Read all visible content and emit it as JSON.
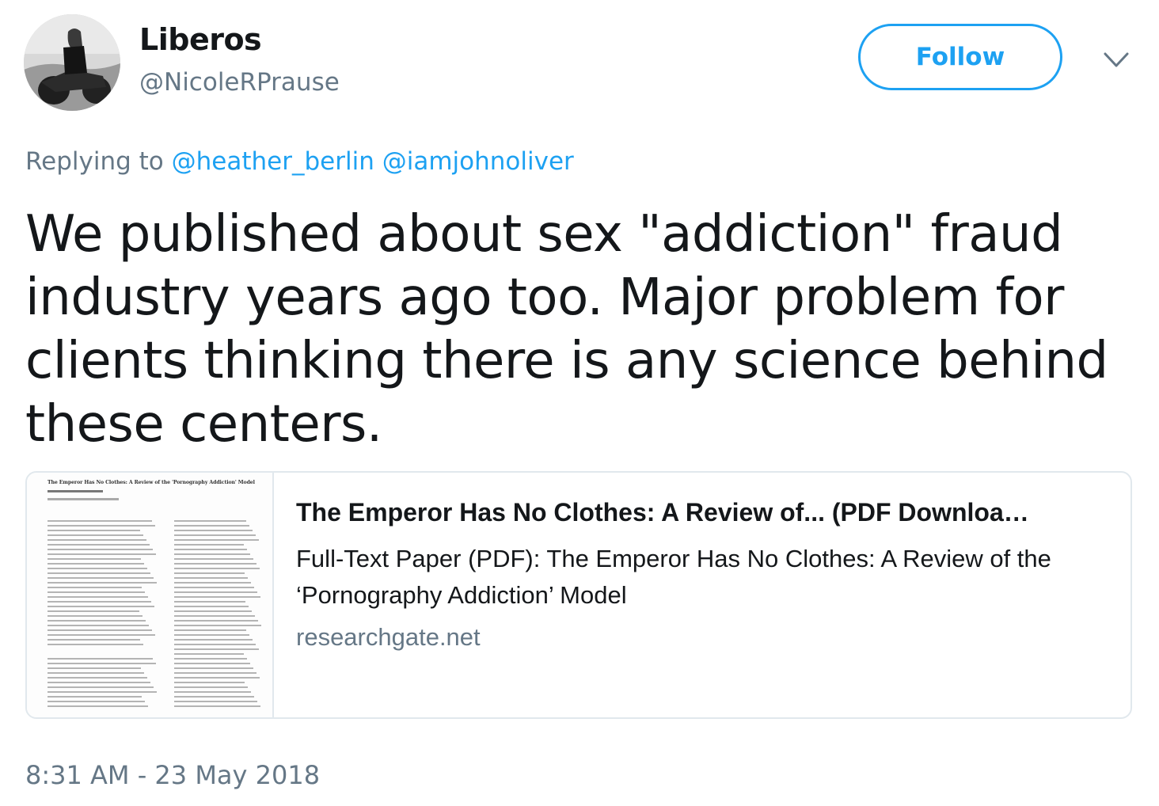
{
  "author": {
    "display_name": "Liberos",
    "handle": "@NicoleRPrause"
  },
  "follow_button": {
    "label": "Follow"
  },
  "menu": {
    "icon": "chevron-down-icon"
  },
  "reply": {
    "prefix": "Replying to",
    "mentions": [
      "@heather_berlin",
      "@iamjohnoliver"
    ]
  },
  "tweet": {
    "text": "We published about sex \"addiction\" fraud industry years ago too. Major problem for clients thinking there is any science behind these centers."
  },
  "link_card": {
    "thumbnail_title": "The Emperor Has No Clothes: A Review of the 'Pornography Addiction' Model",
    "title": "The Emperor Has No Clothes: A Review of... (PDF Downloa…",
    "description": "Full-Text Paper (PDF): The Emperor Has No Clothes: A Review of the ‘Pornography Addiction’ Model",
    "domain": "researchgate.net"
  },
  "timestamp": "8:31 AM - 23 May 2018",
  "colors": {
    "accent": "#1da1f2",
    "secondary_text": "#657786",
    "primary_text": "#14171a",
    "border": "#e1e8ed"
  }
}
